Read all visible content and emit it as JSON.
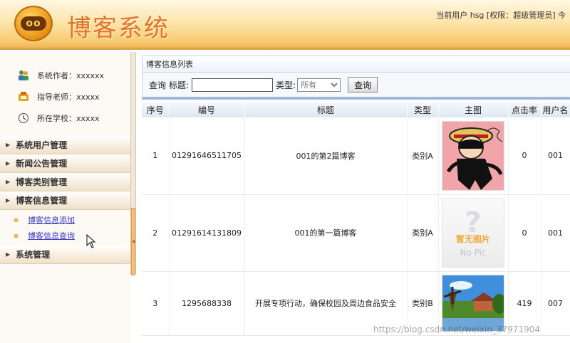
{
  "header": {
    "logo_text": "oo",
    "title": "博客系统",
    "user_info": "当前用户 hsg [权限：超级管理员] 今"
  },
  "sidebar": {
    "info": [
      {
        "icon": "people-icon",
        "text": "系统作者：xxxxxx"
      },
      {
        "icon": "teacher-icon",
        "text": "指导老师：xxxxx"
      },
      {
        "icon": "school-icon",
        "text": "所在学校：xxxxx"
      }
    ],
    "menu": [
      {
        "label": "系统用户管理"
      },
      {
        "label": "新闻公告管理"
      },
      {
        "label": "博客类别管理"
      },
      {
        "label": "博客信息管理",
        "expanded": true,
        "children": [
          {
            "label": "博客信息添加"
          },
          {
            "label": "博客信息查询"
          }
        ]
      },
      {
        "label": "系统管理"
      }
    ]
  },
  "content": {
    "panel_title": "博客信息列表",
    "search": {
      "query_label": "查询",
      "title_label": "标题:",
      "title_value": "",
      "type_label": "类型:",
      "type_selected": "所有",
      "button_label": "查询"
    },
    "table": {
      "columns": [
        "序号",
        "编号",
        "标题",
        "类型",
        "主图",
        "点击率",
        "用户名"
      ],
      "rows": [
        {
          "index": "1",
          "code": "01291646511705",
          "title": "001的第2篇博客",
          "type": "类别A",
          "image": "luffy-image",
          "clicks": "0",
          "user": "001"
        },
        {
          "index": "2",
          "code": "01291614131809",
          "title": "001的第一篇博客",
          "type": "类别A",
          "image": "no-picture",
          "image_text_cn": "暂无图片",
          "image_text_en": "No Pic",
          "clicks": "0",
          "user": "001"
        },
        {
          "index": "3",
          "code": "1295688338",
          "title": "开展专项行动，确保校园及周边食品安全",
          "type": "类别B",
          "image": "landscape-image",
          "clicks": "419",
          "user": "007"
        }
      ]
    }
  },
  "watermark": "https://blog.csdn.net/weixin_37971904",
  "colors": {
    "header_accent": "#e0742a",
    "link": "#3a3ac0",
    "table_header_bg": "#dde7f2"
  }
}
